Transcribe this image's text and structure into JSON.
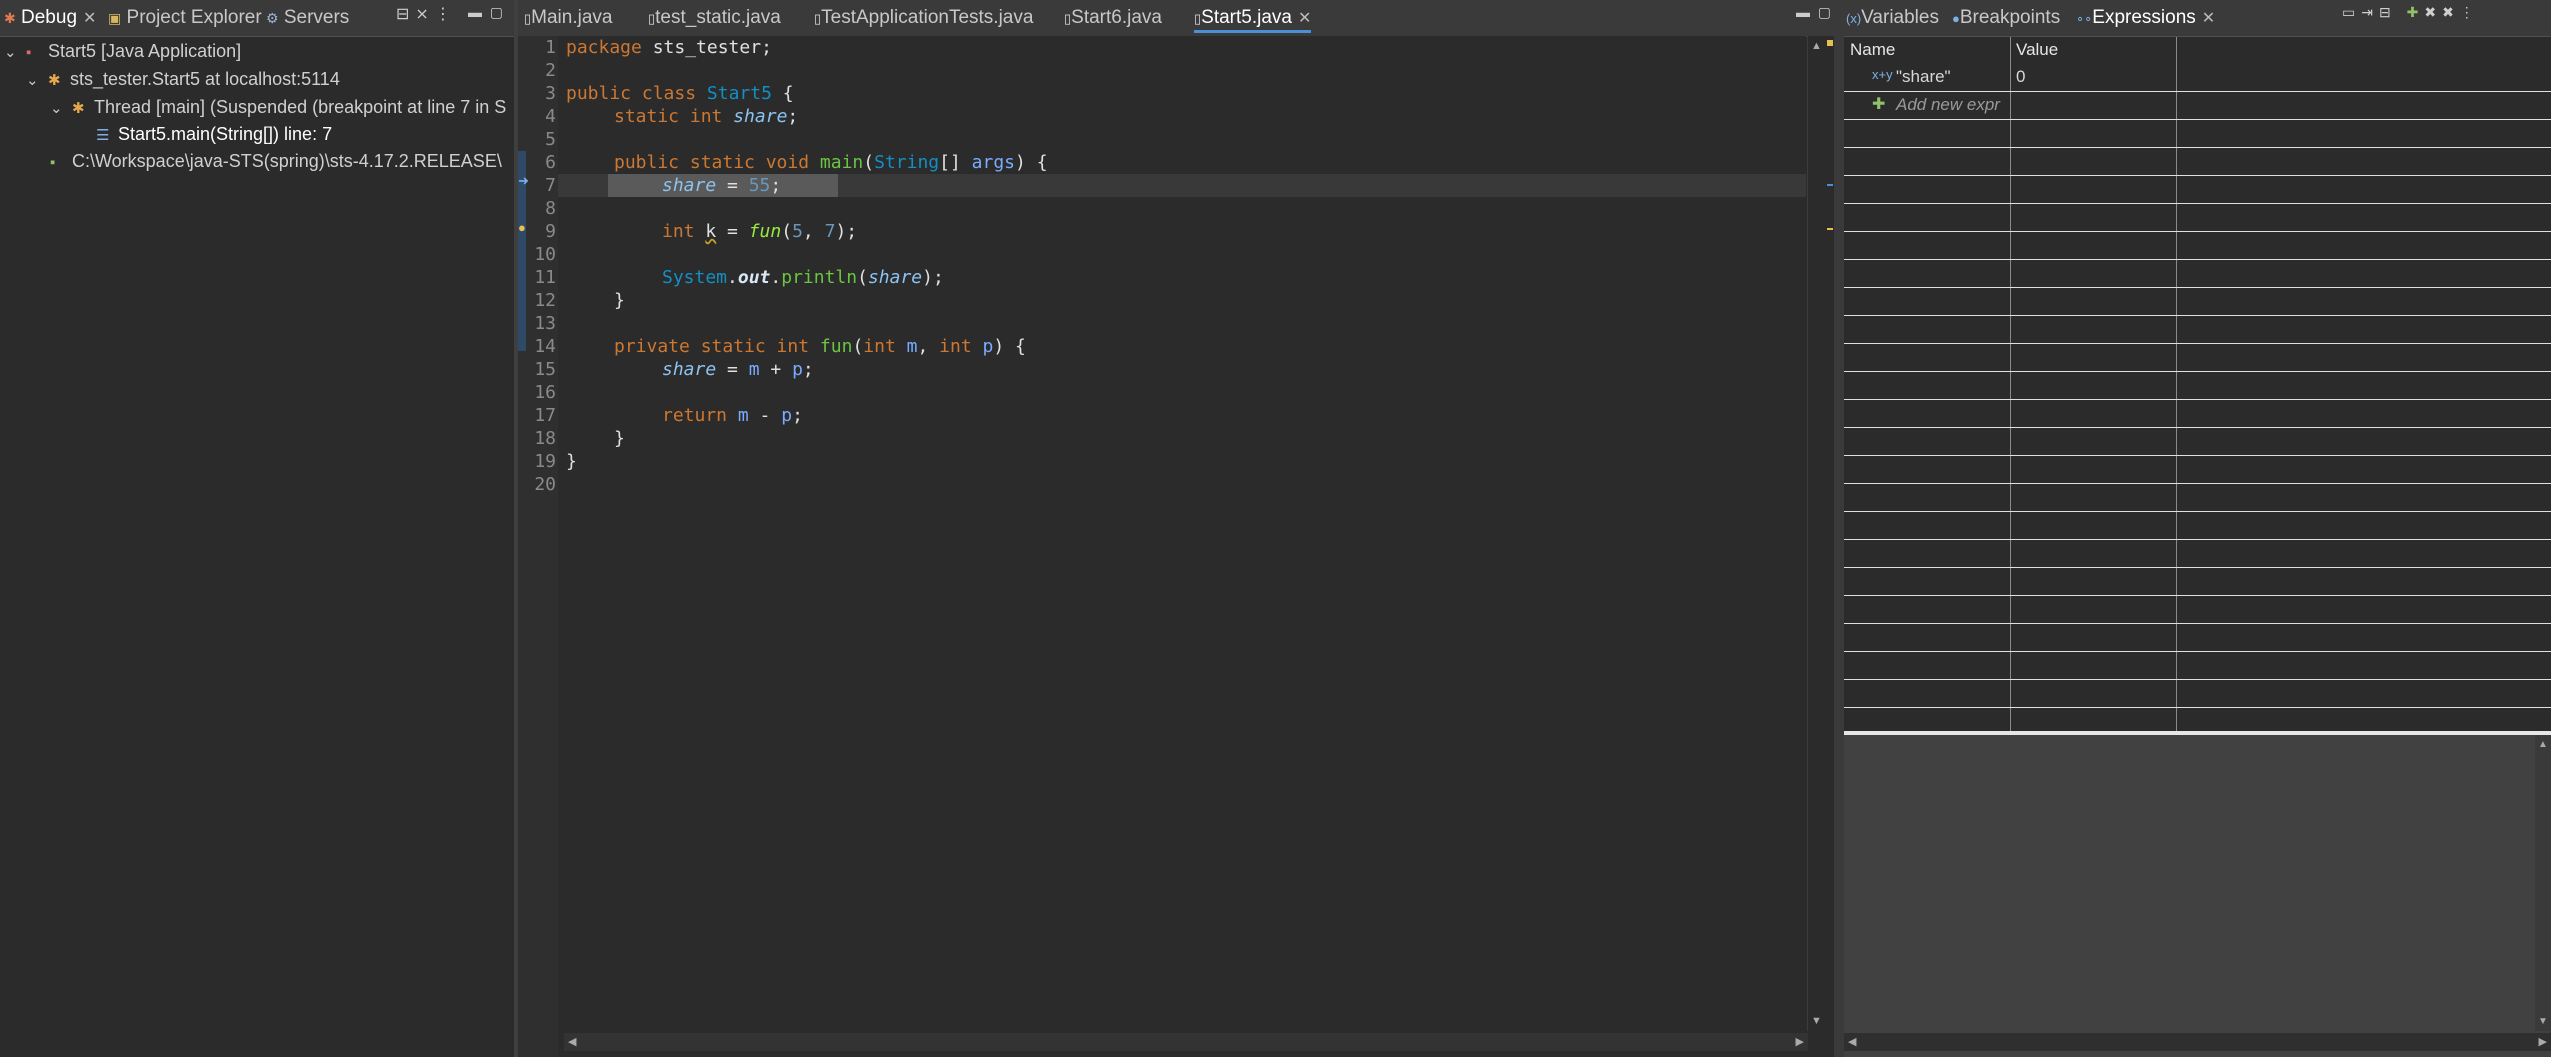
{
  "debug_view": {
    "tabs": [
      {
        "label": "Debug",
        "active": true
      },
      {
        "label": "Project Explorer",
        "active": false
      },
      {
        "label": "Servers",
        "active": false
      }
    ],
    "tree": [
      {
        "label": "Start5 [Java Application]",
        "icon": "java-app-icon"
      },
      {
        "label": "sts_tester.Start5 at localhost:5114",
        "icon": "debug-target-icon"
      },
      {
        "label": "Thread [main] (Suspended (breakpoint at line 7 in S",
        "icon": "thread-icon"
      },
      {
        "label": "Start5.main(String[]) line: 7",
        "icon": "stack-frame-icon"
      },
      {
        "label": "C:\\Workspace\\java-STS(spring)\\sts-4.17.2.RELEASE\\",
        "icon": "process-icon"
      }
    ]
  },
  "editor": {
    "tabs": [
      {
        "label": "Main.java",
        "active": false
      },
      {
        "label": "test_static.java",
        "active": false
      },
      {
        "label": "TestApplicationTests.java",
        "active": false
      },
      {
        "label": "Start6.java",
        "active": false
      },
      {
        "label": "Start5.java",
        "active": true
      }
    ],
    "line_numbers": [
      "1",
      "2",
      "3",
      "4",
      "5",
      "6",
      "7",
      "8",
      "9",
      "10",
      "11",
      "12",
      "13",
      "14",
      "15",
      "16",
      "17",
      "18",
      "19",
      "20"
    ],
    "current_line": "7",
    "breakpoint_line": "9",
    "code": {
      "l1_kw": "package",
      "l1_rest": " sts_tester;",
      "l3_kw": "public class",
      "l3_cls": "Start5",
      "l3_rest": " {",
      "l4_kw": "static int",
      "l4_fld": "share",
      "l4_rest": ";",
      "l6_kw": "public static void",
      "l6_m": "main",
      "l6_p1": "(",
      "l6_cls": "String",
      "l6_p2": "[] ",
      "l6_par": "args",
      "l6_p3": ") {",
      "l7_fld": "share",
      "l7_eq": " = ",
      "l7_num": "55",
      "l7_end": ";",
      "l9_kw": "int",
      "l9_var": "k",
      "l9_eq": " = ",
      "l9_fun": "fun",
      "l9_p1": "(",
      "l9_n1": "5",
      "l9_c": ", ",
      "l9_n2": "7",
      "l9_p2": ");",
      "l11_cls": "System",
      "l11_dot": ".",
      "l11_out": "out",
      "l11_dot2": ".",
      "l11_m": "println",
      "l11_p1": "(",
      "l11_fld": "share",
      "l11_p2": ");",
      "l12": "}",
      "l14_kw": "private static int",
      "l14_m": "fun",
      "l14_p1": "(",
      "l14_kw2": "int",
      "l14_a": "m",
      "l14_c": ", ",
      "l14_kw3": "int",
      "l14_b": "p",
      "l14_p2": ") {",
      "l15_fld": "share",
      "l15_eq": " = ",
      "l15_a": "m",
      "l15_plus": " + ",
      "l15_b": "p",
      "l15_end": ";",
      "l17_kw": "return",
      "l17_a": "m",
      "l17_minus": " - ",
      "l17_b": "p",
      "l17_end": ";",
      "l18": "}",
      "l19": "}"
    }
  },
  "expressions_view": {
    "tabs": [
      {
        "label": "Variables",
        "active": false
      },
      {
        "label": "Breakpoints",
        "active": false
      },
      {
        "label": "Expressions",
        "active": true
      }
    ],
    "columns": [
      "Name",
      "Value"
    ],
    "rows": [
      {
        "name": "\"share\"",
        "value": "0"
      }
    ],
    "add_new": "Add new expr"
  },
  "colors": {
    "background": "#2b2b2b",
    "tab_bar": "#3a3a3a",
    "active_tab_underline": "#4a90d9",
    "current_line_highlight": "#5a5a5a"
  }
}
